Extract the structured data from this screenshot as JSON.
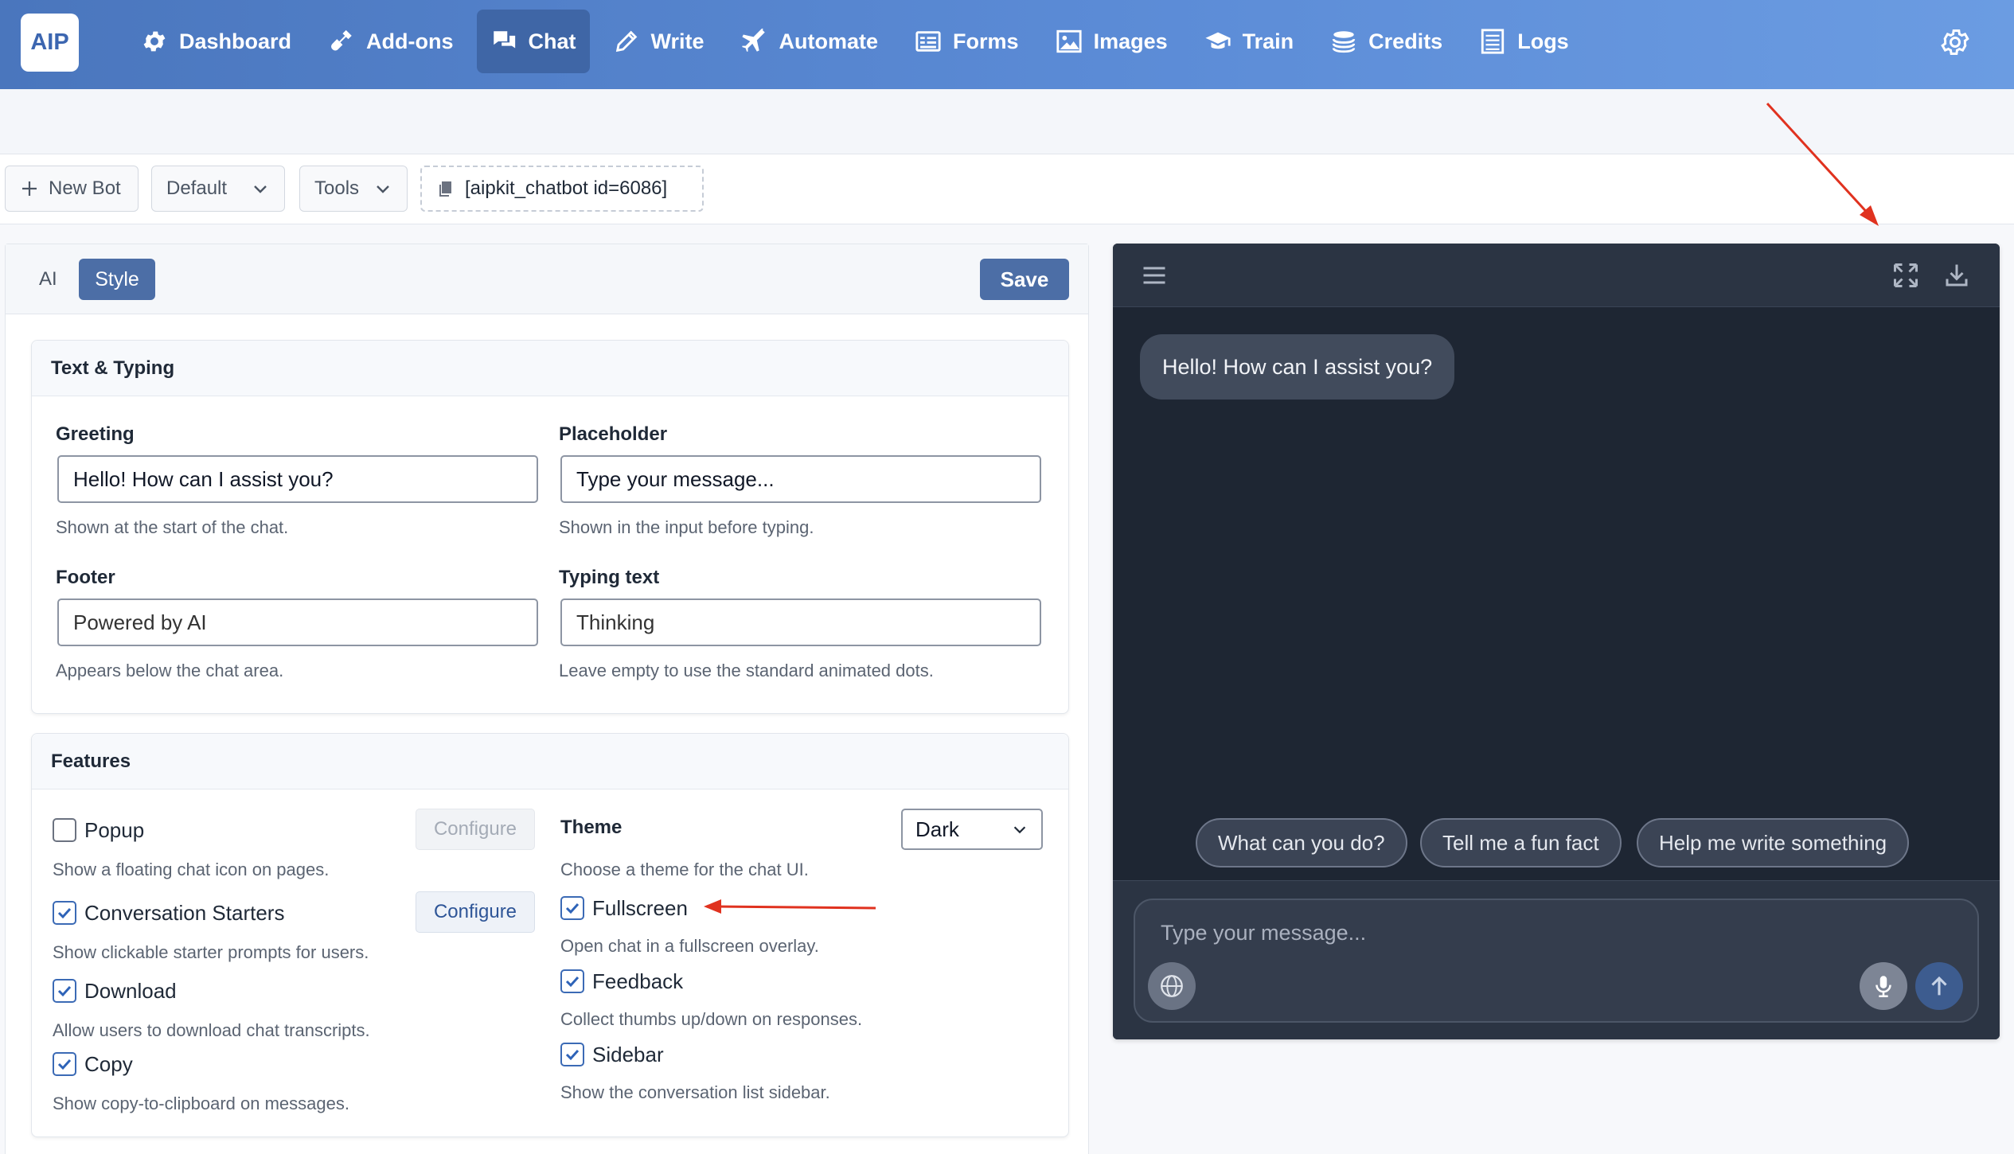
{
  "nav": {
    "logo": "AIP",
    "items": [
      {
        "label": "Dashboard",
        "icon": "gear-icon"
      },
      {
        "label": "Add-ons",
        "icon": "plug-icon"
      },
      {
        "label": "Chat",
        "icon": "chat-icon",
        "active": true
      },
      {
        "label": "Write",
        "icon": "pencil-icon"
      },
      {
        "label": "Automate",
        "icon": "plane-icon"
      },
      {
        "label": "Forms",
        "icon": "form-icon"
      },
      {
        "label": "Images",
        "icon": "image-icon"
      },
      {
        "label": "Train",
        "icon": "graduation-cap-icon"
      },
      {
        "label": "Credits",
        "icon": "coins-icon"
      },
      {
        "label": "Logs",
        "icon": "list-icon"
      }
    ],
    "settings_icon": "settings-gear-icon"
  },
  "toolbar": {
    "new_bot": "New Bot",
    "bot_select": "Default",
    "tools": "Tools",
    "shortcode": "[aipkit_chatbot id=6086]"
  },
  "panel": {
    "tab_ai": "AI",
    "tab_style": "Style",
    "save": "Save"
  },
  "text_typing": {
    "title": "Text & Typing",
    "greeting_label": "Greeting",
    "greeting_value": "Hello! How can I assist you?",
    "greeting_hint": "Shown at the start of the chat.",
    "placeholder_label": "Placeholder",
    "placeholder_value": "Type your message...",
    "placeholder_hint": "Shown in the input before typing.",
    "footer_label": "Footer",
    "footer_value": "Powered by AI",
    "footer_hint": "Appears below the chat area.",
    "typing_label": "Typing text",
    "typing_value": "Thinking",
    "typing_hint": "Leave empty to use the standard animated dots."
  },
  "features": {
    "title": "Features",
    "popup_label": "Popup",
    "popup_checked": false,
    "popup_hint": "Show a floating chat icon on pages.",
    "popup_configure": "Configure",
    "starters_label": "Conversation Starters",
    "starters_checked": true,
    "starters_hint": "Show clickable starter prompts for users.",
    "starters_configure": "Configure",
    "download_label": "Download",
    "download_checked": true,
    "download_hint": "Allow users to download chat transcripts.",
    "copy_label": "Copy",
    "copy_checked": true,
    "copy_hint": "Show copy-to-clipboard on messages.",
    "theme_label": "Theme",
    "theme_hint": "Choose a theme for the chat UI.",
    "theme_value": "Dark",
    "fullscreen_label": "Fullscreen",
    "fullscreen_checked": true,
    "fullscreen_hint": "Open chat in a fullscreen overlay.",
    "feedback_label": "Feedback",
    "feedback_checked": true,
    "feedback_hint": "Collect thumbs up/down on responses.",
    "sidebar_label": "Sidebar",
    "sidebar_checked": true,
    "sidebar_hint": "Show the conversation list sidebar."
  },
  "chat_preview": {
    "greeting": "Hello! How can I assist you?",
    "starters": [
      "What can you do?",
      "Tell me a fun fact",
      "Help me write something"
    ],
    "input_placeholder": "Type your message...",
    "header_icons": [
      "menu-icon",
      "fullscreen-icon",
      "download-icon"
    ],
    "composer_icons": [
      "web-search-icon",
      "microphone-icon",
      "send-arrow-icon"
    ]
  },
  "colors": {
    "nav_gradient_start": "#4a76bd",
    "nav_gradient_end": "#6b9ce2",
    "accent": "#4c6ea6",
    "chat_bg": "#1e2633",
    "annotation_arrow": "#e0321f"
  }
}
